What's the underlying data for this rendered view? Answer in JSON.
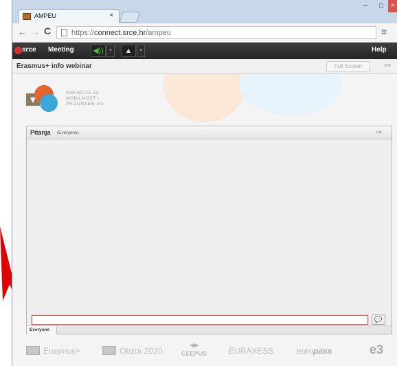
{
  "browser": {
    "tab_title": "AMPEU",
    "tab_close": "×",
    "url_prefix": "https://",
    "url_host": "connect.srce.hr",
    "url_path": "/ampeu",
    "nav_back": "←",
    "nav_forward": "→",
    "nav_reload": "C",
    "menu": "≡",
    "window_min": "–",
    "window_max": "□",
    "window_close": "×"
  },
  "appbar": {
    "logo_text": "srce",
    "meeting_label": "Meeting",
    "speaker_icon": "◀))",
    "dropdown_glyph": "▾",
    "person_icon": "▲",
    "help_label": "Help"
  },
  "meeting": {
    "title": "Erasmus+ info webinar",
    "fullscreen_label": "Full Screen",
    "menu_glyph": "≡▾"
  },
  "agency": {
    "line1": "AGENCIJA ZA",
    "line2": "MOBILNOST I",
    "line3": "PROGRAME EU"
  },
  "pod": {
    "title": "Pitanja",
    "audience": "(Everyone)",
    "menu_glyph": "≡▾",
    "input_value": "",
    "send_icon": "💬",
    "tab_label": "Everyone"
  },
  "footer": {
    "erasmus": "Erasmus+",
    "obzor": "Obzor 2020.",
    "ceepus": "CEEPUS",
    "euraxess": "EURAXESS",
    "europass_a": "euro",
    "europass_b": "pass",
    "e3": "e3"
  },
  "colors": {
    "accent_red": "#d7322d",
    "speaker_green": "#4bbf3e",
    "titlebar_blue": "#c9d7ea",
    "annotation_red": "#e00000"
  }
}
